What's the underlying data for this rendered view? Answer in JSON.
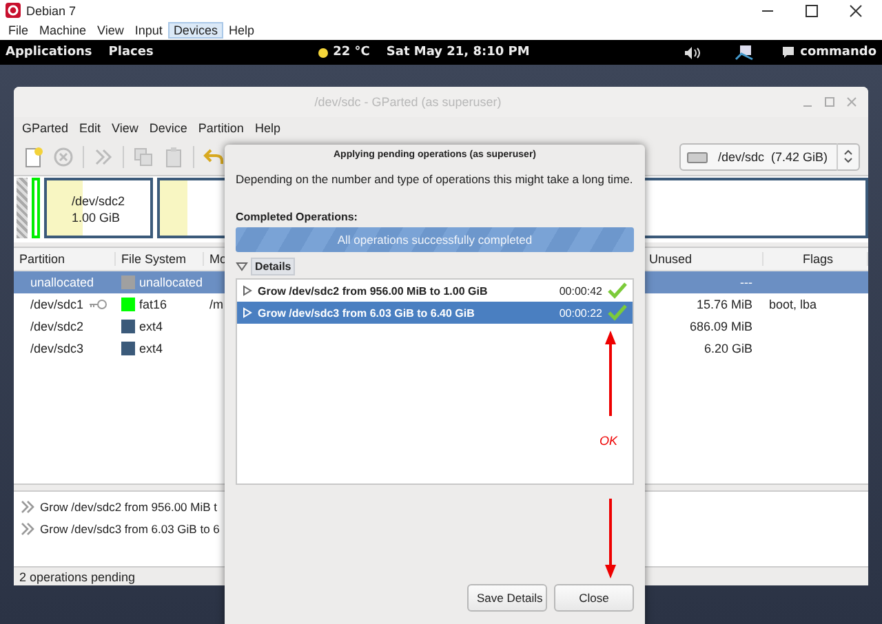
{
  "host_window": {
    "title": "Debian 7",
    "menu": [
      {
        "label": "File",
        "selected": false
      },
      {
        "label": "Machine",
        "selected": false
      },
      {
        "label": "View",
        "selected": false
      },
      {
        "label": "Input",
        "selected": false
      },
      {
        "label": "Devices",
        "selected": true
      },
      {
        "label": "Help",
        "selected": false
      }
    ]
  },
  "top_bar": {
    "menus": [
      "Applications",
      "Places"
    ],
    "weather": "22 °C",
    "clock": "Sat May 21,  8:10 PM",
    "user": "commando"
  },
  "gparted": {
    "title": "/dev/sdc - GParted (as superuser)",
    "menu": [
      "GParted",
      "Edit",
      "View",
      "Device",
      "Partition",
      "Help"
    ],
    "device": "/dev/sdc  (7.42 GiB)",
    "disk_map": [
      {
        "kind": "unallocated"
      },
      {
        "kind": "fat16"
      },
      {
        "kind": "ext4",
        "name": "/dev/sdc2",
        "size": "1.00 GiB",
        "level": 0.35
      },
      {
        "kind": "ext4",
        "level": 0.04
      }
    ],
    "columns": [
      "Partition",
      "File System",
      "Mo",
      "Unused",
      "Flags"
    ],
    "rows": [
      {
        "partition": "unallocated",
        "fs": "unallocated",
        "color": "#a0a0a0",
        "mount": "",
        "unused": "---",
        "flags": "",
        "locked": false,
        "selected": true
      },
      {
        "partition": "/dev/sdc1",
        "fs": "fat16",
        "color": "#00ff00",
        "mount": "/m",
        "unused": "15.76 MiB",
        "flags": "boot, lba",
        "locked": true,
        "selected": false
      },
      {
        "partition": "/dev/sdc2",
        "fs": "ext4",
        "color": "#3b5a7a",
        "mount": "",
        "unused": "686.09 MiB",
        "flags": "",
        "locked": false,
        "selected": false
      },
      {
        "partition": "/dev/sdc3",
        "fs": "ext4",
        "color": "#3b5a7a",
        "mount": "",
        "unused": "6.20 GiB",
        "flags": "",
        "locked": false,
        "selected": false
      }
    ],
    "pending": [
      "Grow /dev/sdc2 from 956.00 MiB t",
      "Grow /dev/sdc3 from 6.03 GiB to 6"
    ],
    "status": "2 operations pending"
  },
  "dialog": {
    "title": "Applying pending operations (as superuser)",
    "description": "Depending on the number and type of operations this might take a long time.",
    "heading": "Completed Operations:",
    "progress": {
      "text": "All operations successfully completed",
      "level": 1
    },
    "details": {
      "label": "Details",
      "expanded": true
    },
    "operations": [
      {
        "text": "Grow /dev/sdc2 from 956.00 MiB to 1.00 GiB",
        "time": "00:00:42",
        "success": true,
        "selected": false
      },
      {
        "text": "Grow /dev/sdc3 from 6.03 GiB to 6.40 GiB",
        "time": "00:00:22",
        "success": true,
        "selected": true
      }
    ],
    "buttons": [
      "Save Details",
      "Close"
    ],
    "annotation": "OK"
  }
}
